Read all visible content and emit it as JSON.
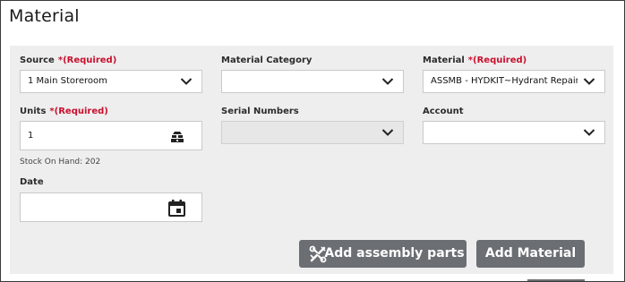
{
  "page": {
    "title": "Material"
  },
  "required_text": "(Required)",
  "form": {
    "source": {
      "label": "Source",
      "value": "1 Main Storeroom"
    },
    "material_category": {
      "label": "Material Category",
      "value": ""
    },
    "material": {
      "label": "Material",
      "value": "ASSMB - HYDKIT~Hydrant Repair K"
    },
    "units": {
      "label": "Units",
      "value": "1"
    },
    "serial_numbers": {
      "label": "Serial Numbers",
      "value": ""
    },
    "account": {
      "label": "Account",
      "value": ""
    },
    "stock_on_hand": "Stock On Hand: 202",
    "date": {
      "label": "Date",
      "value": ""
    }
  },
  "buttons": {
    "add_assembly_parts": "Add assembly parts",
    "add_material": "Add Material"
  },
  "colors": {
    "required": "#c8102e",
    "button_bg": "#6b6e73",
    "panel_bg": "#eeeeee"
  },
  "icons": {
    "dropdown": "chevron-down-icon",
    "units": "inventory-boxes-icon",
    "date": "calendar-icon",
    "assembly": "assembly-tools-icon"
  }
}
